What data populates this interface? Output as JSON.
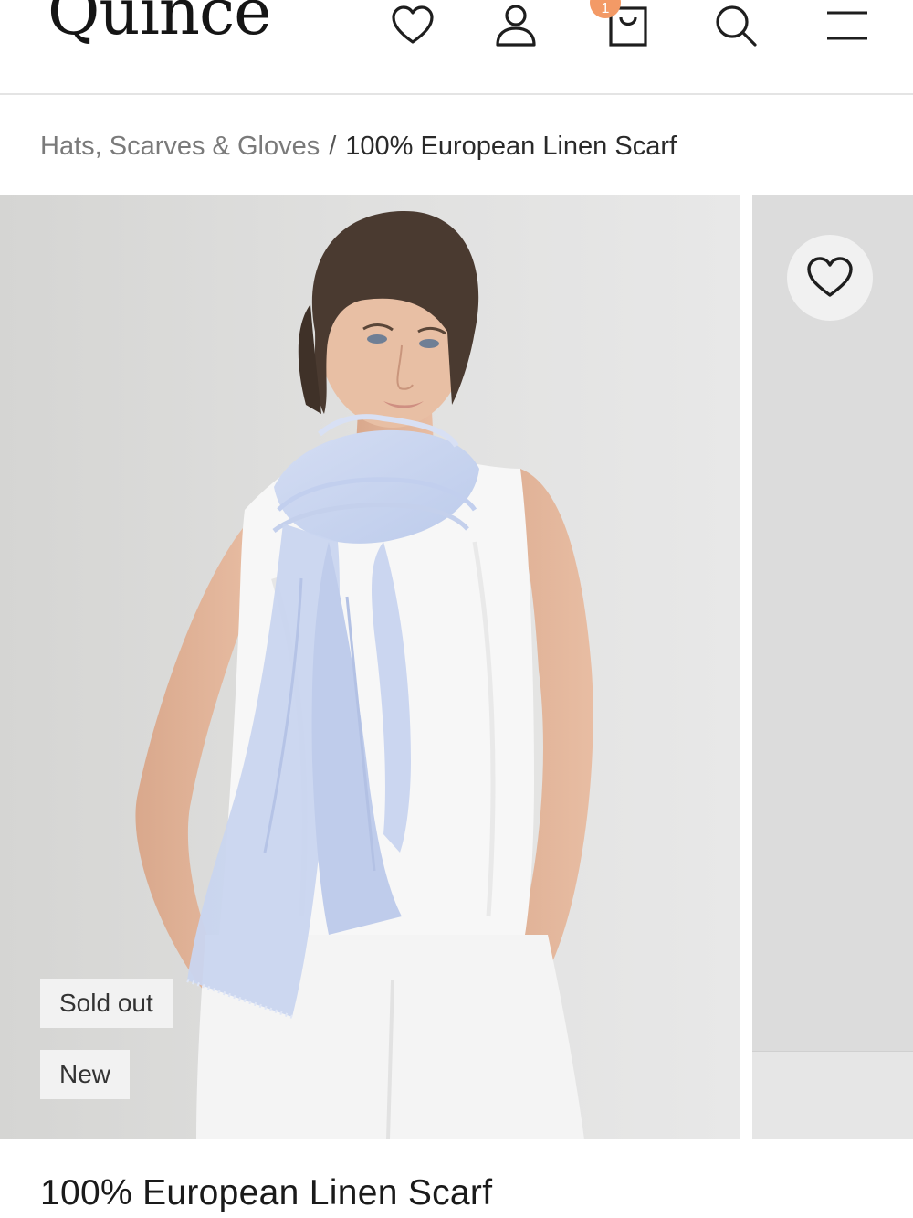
{
  "header": {
    "logo_text": "Quince",
    "cart_count": "1",
    "icons": [
      "heart-icon",
      "account-icon",
      "cart-icon",
      "search-icon",
      "menu-icon"
    ]
  },
  "breadcrumb": {
    "parent": "Hats, Scarves & Gloves",
    "separator": "/",
    "current": "100% European Linen Scarf"
  },
  "gallery": {
    "main_image": "model wearing light blue linen scarf and white sleeveless top",
    "badges": [
      "Sold out",
      "New"
    ]
  },
  "product": {
    "title": "100% European Linen Scarf"
  },
  "colors": {
    "accent_badge": "#f39a66",
    "scarf": "#c8d4ef",
    "background": "#dedede"
  }
}
